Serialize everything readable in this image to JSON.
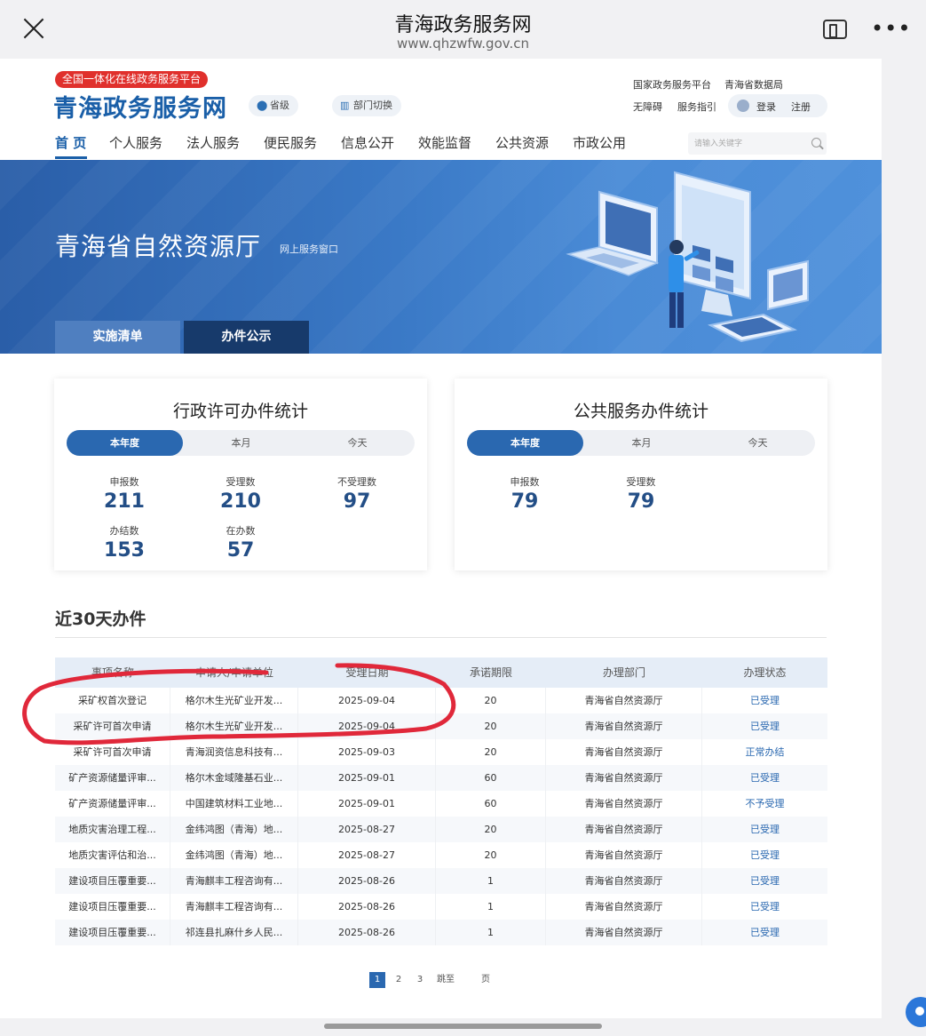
{
  "browser": {
    "title": "青海政务服务网",
    "url": "www.qhzwfw.gov.cn"
  },
  "header": {
    "badge": "全国一体化在线政务服务平台",
    "logo": "青海政务服务网",
    "region_pill": "省级",
    "dept_pill": "部门切换",
    "links": {
      "national_platform": "国家政务服务平台",
      "data_bureau": "青海省数据局",
      "accessibility": "无障碍",
      "guide": "服务指引",
      "login": "登录",
      "register": "注册"
    },
    "search_placeholder": "请输入关键字"
  },
  "nav": [
    "首 页",
    "个人服务",
    "法人服务",
    "便民服务",
    "信息公开",
    "效能监督",
    "公共资源",
    "市政公用"
  ],
  "banner": {
    "title": "青海省自然资源厅",
    "subtitle": "网上服务窗口",
    "tabs": [
      "实施清单",
      "办件公示"
    ]
  },
  "cards": [
    {
      "title": "行政许可办件统计",
      "segments": [
        "本年度",
        "本月",
        "今天"
      ],
      "stats": [
        {
          "label": "申报数",
          "value": "211"
        },
        {
          "label": "受理数",
          "value": "210"
        },
        {
          "label": "不受理数",
          "value": "97"
        },
        {
          "label": "办结数",
          "value": "153"
        },
        {
          "label": "在办数",
          "value": "57"
        }
      ]
    },
    {
      "title": "公共服务办件统计",
      "segments": [
        "本年度",
        "本月",
        "今天"
      ],
      "stats": [
        {
          "label": "申报数",
          "value": "79"
        },
        {
          "label": "受理数",
          "value": "79"
        }
      ]
    }
  ],
  "recent": {
    "title": "近30天办件",
    "columns": [
      "事项名称",
      "申请人/申请单位",
      "受理日期",
      "承诺期限",
      "办理部门",
      "办理状态"
    ],
    "rows": [
      [
        "采矿权首次登记",
        "格尔木生光矿业开发...",
        "2025-09-04",
        "20",
        "青海省自然资源厅",
        "已受理"
      ],
      [
        "采矿许可首次申请",
        "格尔木生光矿业开发...",
        "2025-09-04",
        "20",
        "青海省自然资源厅",
        "已受理"
      ],
      [
        "采矿许可首次申请",
        "青海润资信息科技有...",
        "2025-09-03",
        "20",
        "青海省自然资源厅",
        "正常办结"
      ],
      [
        "矿产资源储量评审...",
        "格尔木金域隆基石业...",
        "2025-09-01",
        "60",
        "青海省自然资源厅",
        "已受理"
      ],
      [
        "矿产资源储量评审...",
        "中国建筑材料工业地...",
        "2025-09-01",
        "60",
        "青海省自然资源厅",
        "不予受理"
      ],
      [
        "地质灾害治理工程...",
        "金纬鸿图（青海）地...",
        "2025-08-27",
        "20",
        "青海省自然资源厅",
        "已受理"
      ],
      [
        "地质灾害评估和治...",
        "金纬鸿图（青海）地...",
        "2025-08-27",
        "20",
        "青海省自然资源厅",
        "已受理"
      ],
      [
        "建设项目压覆重要...",
        "青海麒丰工程咨询有...",
        "2025-08-26",
        "1",
        "青海省自然资源厅",
        "已受理"
      ],
      [
        "建设项目压覆重要...",
        "青海麒丰工程咨询有...",
        "2025-08-26",
        "1",
        "青海省自然资源厅",
        "已受理"
      ],
      [
        "建设项目压覆重要...",
        "祁连县扎麻什乡人民...",
        "2025-08-26",
        "1",
        "青海省自然资源厅",
        "已受理"
      ]
    ]
  },
  "pagination": {
    "pages": [
      "1",
      "2",
      "3"
    ],
    "jump_label": "跳至",
    "page_label": "页"
  },
  "colors": {
    "brand": "#1a5fa8",
    "badge": "#e0302c",
    "annotation": "#e0283a"
  }
}
